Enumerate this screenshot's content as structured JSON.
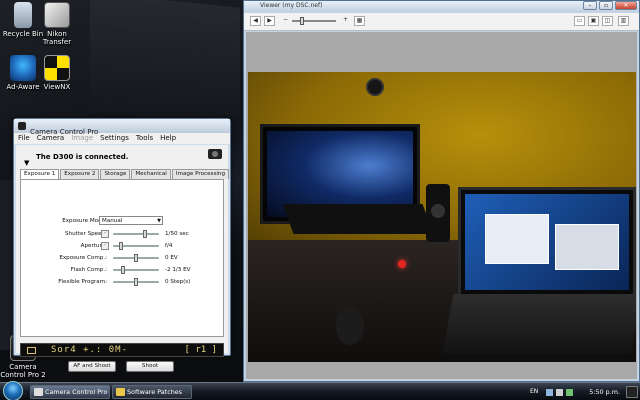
{
  "desktop": {
    "icons": [
      {
        "label": "Recycle Bin"
      },
      {
        "label": "Nikon Transfer"
      },
      {
        "label": "Ad-Aware"
      },
      {
        "label": "ViewNX"
      },
      {
        "label": "Camera Control Pro 2"
      }
    ]
  },
  "ccp": {
    "title": "Camera Control Pro",
    "menu": [
      "File",
      "Camera",
      "Image",
      "Settings",
      "Tools",
      "Help"
    ],
    "status": "The D300 is connected.",
    "tabs": [
      "Exposure 1",
      "Exposure 2",
      "Storage",
      "Mechanical",
      "Image Processing"
    ],
    "exposure_mode": {
      "label": "Exposure Mode:",
      "value": "Manual"
    },
    "settings": [
      {
        "label": "Shutter Speed:",
        "value": "1/50 sec"
      },
      {
        "label": "Aperture:",
        "value": "f/4"
      },
      {
        "label": "Exposure Comp.:",
        "value": "0 EV"
      },
      {
        "label": "Flash Comp.:",
        "value": "-2 1/3 EV"
      },
      {
        "label": "Flexible Program:",
        "value": "0 Step(s)"
      }
    ],
    "lcd": {
      "main": "Sor4 +.: 0M- ",
      "right": "[ r1 ]"
    },
    "buttons": {
      "af_shoot": "AF and Shoot",
      "shoot": "Shoot"
    }
  },
  "viewer": {
    "title": "Viewer (my DSC.nef)"
  },
  "taskbar": {
    "tasks": [
      "Camera Control Pro",
      "Software Patches"
    ],
    "language": "EN",
    "clock": "5:50 p.m."
  },
  "colors": {
    "lcd_text": "#e8d580",
    "window_frame": "#cfdcea",
    "taskbar": "#141a24"
  }
}
